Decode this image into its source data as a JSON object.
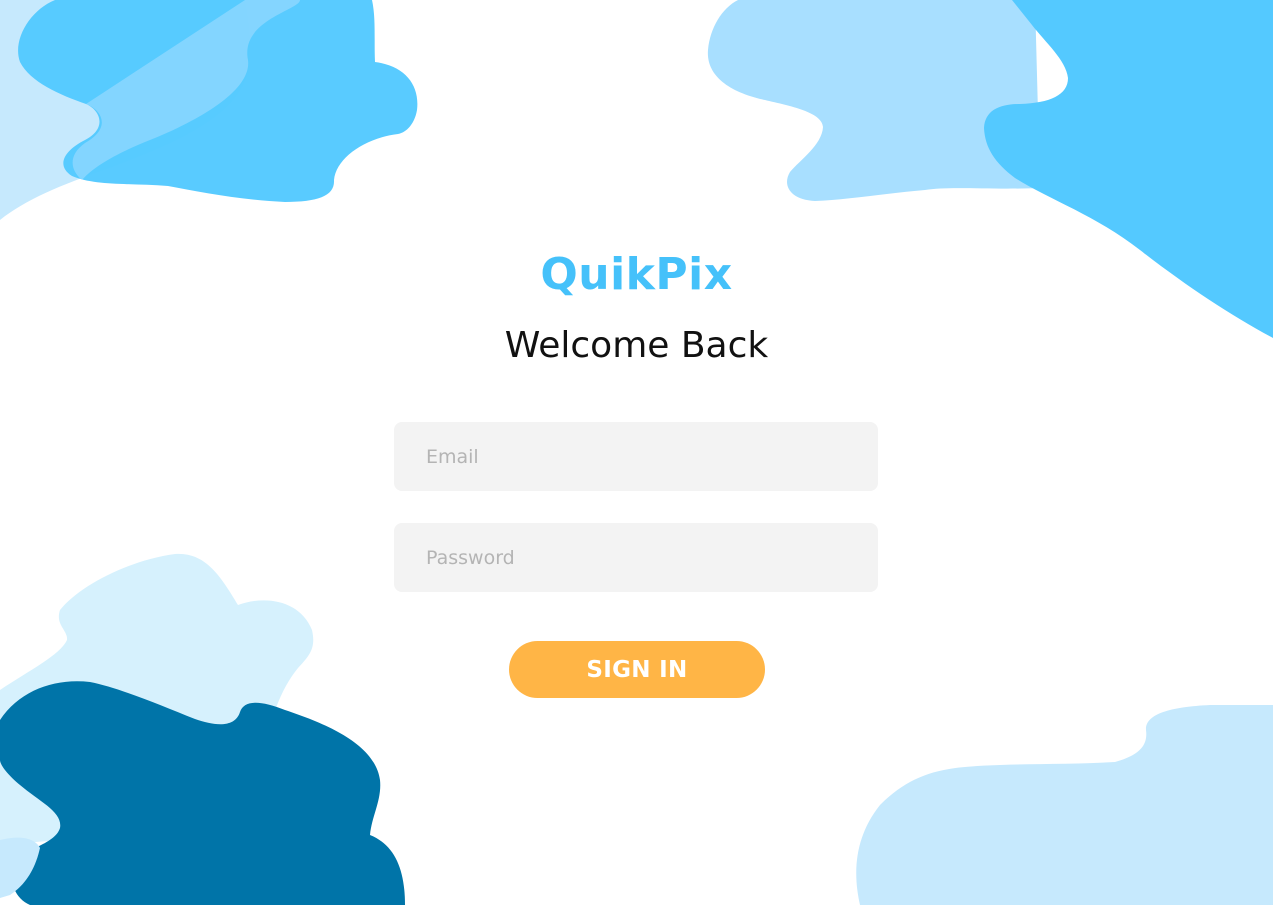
{
  "app": {
    "brand": "QuikPix",
    "heading": "Welcome Back"
  },
  "form": {
    "email": {
      "placeholder": "Email",
      "value": ""
    },
    "password": {
      "placeholder": "Password",
      "value": ""
    },
    "submit_label": "SIGN IN"
  },
  "colors": {
    "brand": "#45c1fa",
    "button": "#ffb546",
    "blob_sky": "#54c9ff",
    "blob_light": "#a8dfff",
    "blob_pale": "#c6e9fd",
    "blob_palest": "#d6f1fd",
    "blob_dark": "#0074a8"
  },
  "decorations": {
    "background_shapes": [
      "blob-top-left",
      "blob-top-right",
      "blob-bottom-left",
      "blob-bottom-right"
    ]
  }
}
